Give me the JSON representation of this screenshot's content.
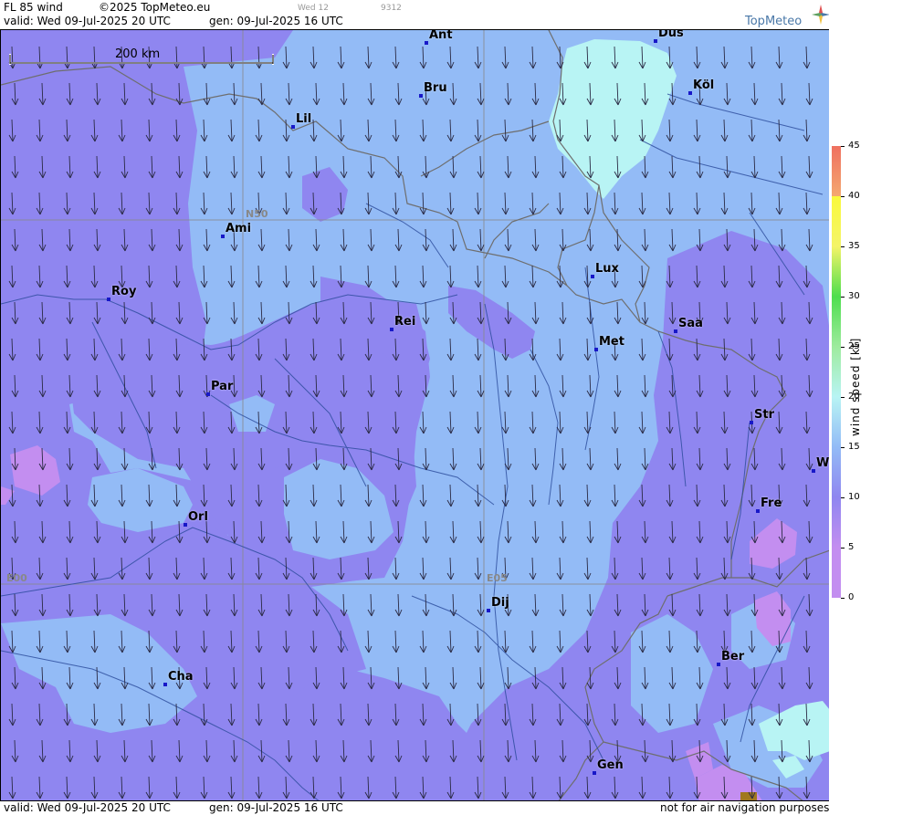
{
  "header": {
    "product": "FL 85 wind",
    "copyright": "©2025 TopMeteo.eu",
    "valid": "valid:  Wed  09-Jul-2025  20 UTC",
    "generated": "gen: 09-Jul-2025 16 UTC",
    "small_day": "Wed 12",
    "small_code": "9312",
    "brand": "TopMeteo"
  },
  "scale_bar": {
    "label": "200 km"
  },
  "grid_labels": {
    "lat": "N50",
    "lon0": "E00",
    "lon5": "E05"
  },
  "cities": [
    {
      "name": "Ant"
    },
    {
      "name": "Düs"
    },
    {
      "name": "Bru"
    },
    {
      "name": "Köl"
    },
    {
      "name": "Lil"
    },
    {
      "name": "Ami"
    },
    {
      "name": "Lux"
    },
    {
      "name": "Roy"
    },
    {
      "name": "Rei"
    },
    {
      "name": "Saa"
    },
    {
      "name": "Met"
    },
    {
      "name": "Par"
    },
    {
      "name": "Str"
    },
    {
      "name": "W"
    },
    {
      "name": "Fre"
    },
    {
      "name": "Orl"
    },
    {
      "name": "Dij"
    },
    {
      "name": "Ber"
    },
    {
      "name": "Cha"
    },
    {
      "name": "Gen"
    }
  ],
  "legend": {
    "title": "wind  speed  [kt]",
    "ticks": [
      "45",
      "40",
      "35",
      "30",
      "25",
      "20",
      "15",
      "10",
      "5",
      "0"
    ],
    "colors": {
      "c0": "#c38ef0",
      "c5": "#8f86f0",
      "c10": "#93bbf6",
      "c15": "#b8f4f4",
      "c20": "#9eeb9e",
      "c25": "#4ede4e",
      "c30": "#f4f468",
      "c35": "#f9f93c",
      "c40": "#f4a870",
      "c45": "#ef7060"
    }
  },
  "footer": {
    "valid": "valid:  Wed  09-Jul-2025  20 UTC",
    "generated": "gen: 09-Jul-2025 16 UTC",
    "disclaimer": "not for air navigation purposes"
  }
}
